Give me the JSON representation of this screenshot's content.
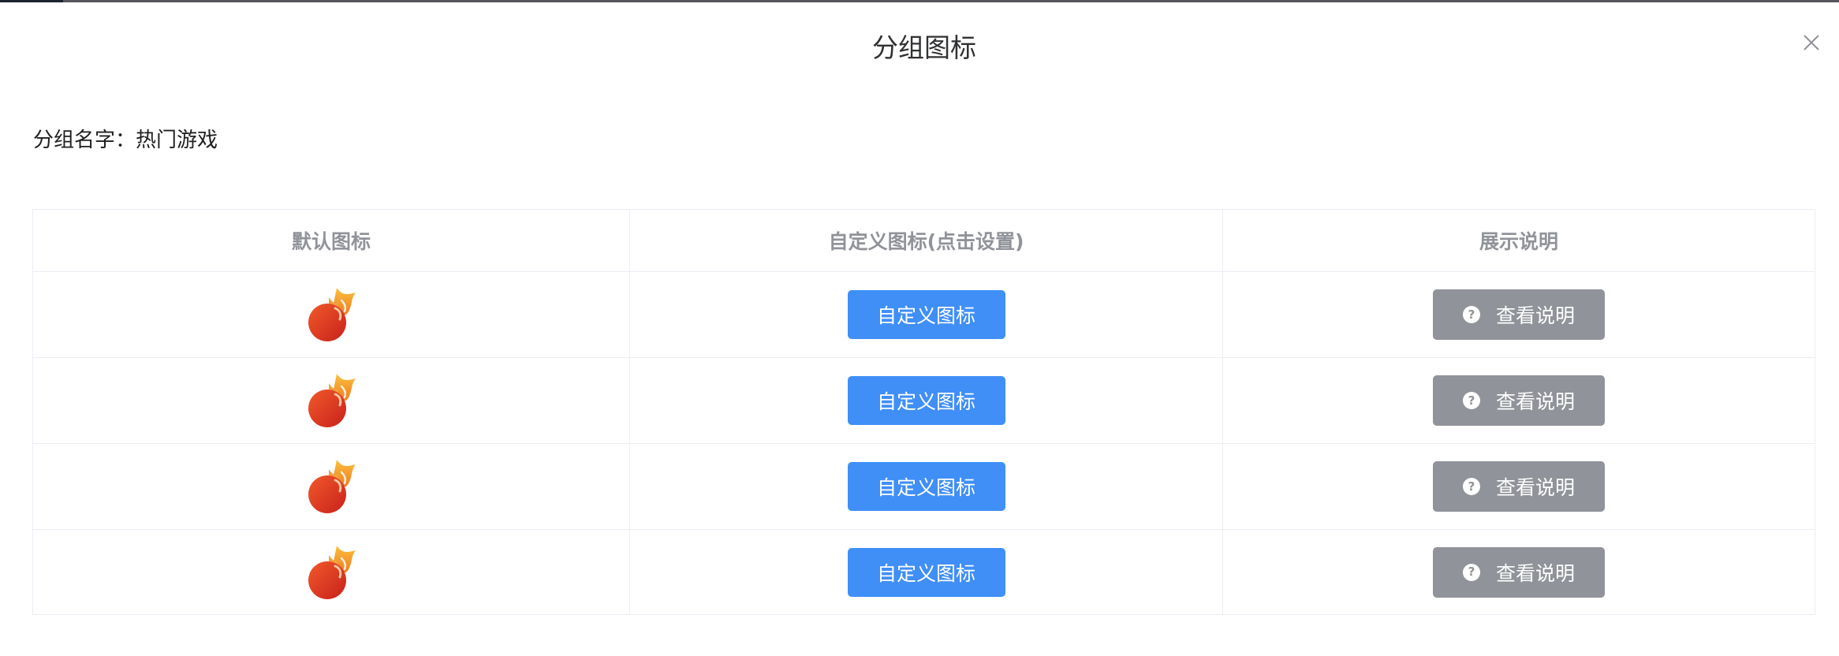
{
  "dialog": {
    "title": "分组图标",
    "close_icon": "close-icon"
  },
  "group": {
    "label": "分组名字：",
    "value": "热门游戏"
  },
  "table": {
    "headers": [
      "默认图标",
      "自定义图标(点击设置)",
      "展示说明"
    ],
    "rows": [
      {
        "default_icon": "fire-icon",
        "custom_button": "自定义图标",
        "info_button": "查看说明"
      },
      {
        "default_icon": "fire-icon",
        "custom_button": "自定义图标",
        "info_button": "查看说明"
      },
      {
        "default_icon": "fire-icon",
        "custom_button": "自定义图标",
        "info_button": "查看说明"
      },
      {
        "default_icon": "fire-icon",
        "custom_button": "自定义图标",
        "info_button": "查看说明"
      }
    ]
  },
  "colors": {
    "primary": "#3f8ff7",
    "info": "#909399",
    "header_text": "#909399",
    "border": "#ebeef5"
  }
}
